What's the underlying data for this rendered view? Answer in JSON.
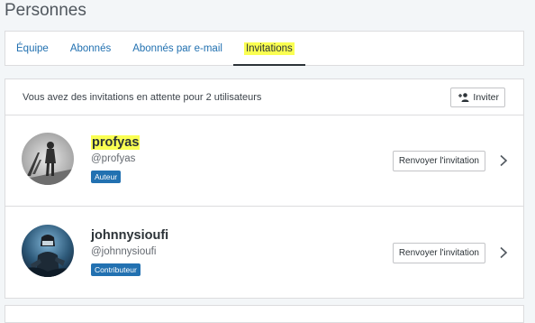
{
  "page": {
    "title": "Personnes"
  },
  "tabs": [
    {
      "label": "Équipe",
      "active": false
    },
    {
      "label": "Abonnés",
      "active": false
    },
    {
      "label": "Abonnés par e-mail",
      "active": false
    },
    {
      "label": "Invitations",
      "active": true
    }
  ],
  "invites": {
    "summary": "Vous avez des invitations en attente pour 2 utilisateurs",
    "invite_button": "Inviter",
    "invite_icon": "person-add-icon",
    "users": [
      {
        "name": "profyas",
        "handle": "@profyas",
        "role": "Auteur",
        "resend_label": "Renvoyer l'invitation",
        "highlighted": true
      },
      {
        "name": "johnnysioufi",
        "handle": "@johnnysioufi",
        "role": "Contributeur",
        "resend_label": "Renvoyer l'invitation",
        "highlighted": false
      }
    ]
  },
  "colors": {
    "accent": "#2271b1",
    "highlight": "#faff52",
    "background": "#f3f6f8"
  }
}
